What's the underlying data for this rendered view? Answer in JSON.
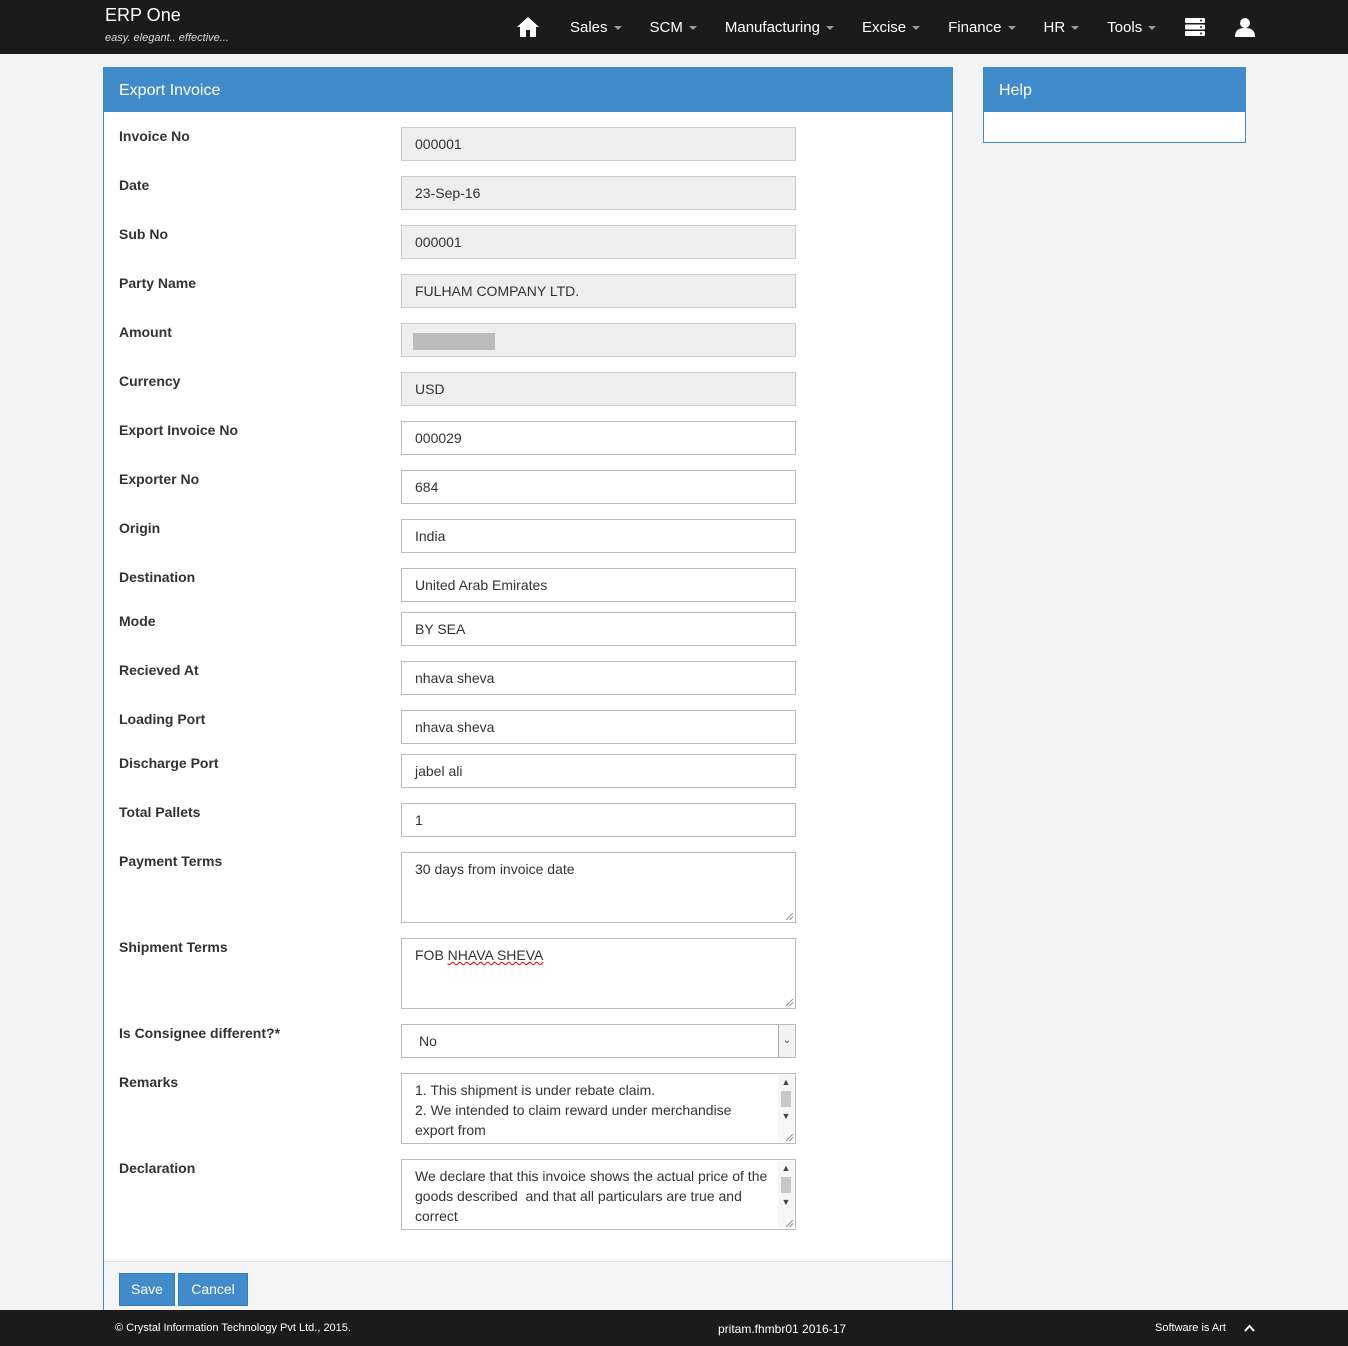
{
  "brand": {
    "title": "ERP One",
    "tagline": "easy. elegant.. effective..."
  },
  "nav": {
    "items": [
      "Sales",
      "SCM",
      "Manufacturing",
      "Excise",
      "Finance",
      "HR",
      "Tools"
    ]
  },
  "form": {
    "title": "Export Invoice",
    "fields": [
      {
        "label": "Invoice No",
        "value": "000001"
      },
      {
        "label": "Date",
        "value": "23-Sep-16"
      },
      {
        "label": "Sub No",
        "value": "000001"
      },
      {
        "label": "Party Name",
        "value": "FULHAM COMPANY LTD."
      },
      {
        "label": "Amount",
        "value": ""
      },
      {
        "label": "Currency",
        "value": "USD"
      },
      {
        "label": "Export Invoice No",
        "value": "000029"
      },
      {
        "label": "Exporter No",
        "value": "684"
      },
      {
        "label": "Origin",
        "value": "India"
      },
      {
        "label": "Destination",
        "value": "United Arab Emirates"
      },
      {
        "label": "Mode",
        "value": "BY SEA"
      },
      {
        "label": "Recieved At",
        "value": "nhava sheva"
      },
      {
        "label": "Loading Port",
        "value": "nhava sheva"
      },
      {
        "label": "Discharge Port",
        "value": "jabel ali"
      },
      {
        "label": "Total Pallets",
        "value": "1"
      },
      {
        "label": "Payment Terms",
        "value": "30 days from invoice date"
      },
      {
        "label": "Shipment Terms",
        "value_prefix": "FOB ",
        "value_misspelled": "NHAVA SHEVA"
      },
      {
        "label": "Is Consignee different?*",
        "value": "No"
      },
      {
        "label": "Remarks",
        "value": "1. This shipment is under rebate claim.\n2. We intended to claim reward under merchandise export from"
      },
      {
        "label": "Declaration",
        "value": "We declare that this invoice shows the actual price of the goods described  and that all particulars are true and correct"
      }
    ],
    "save_label": "Save",
    "cancel_label": "Cancel"
  },
  "help": {
    "title": "Help"
  },
  "footer": {
    "copyright": "© Crystal Information Technology Pvt Ltd., 2015.",
    "session": "pritam.fhmbr01 2016-17",
    "slogan": "Software is Art"
  }
}
